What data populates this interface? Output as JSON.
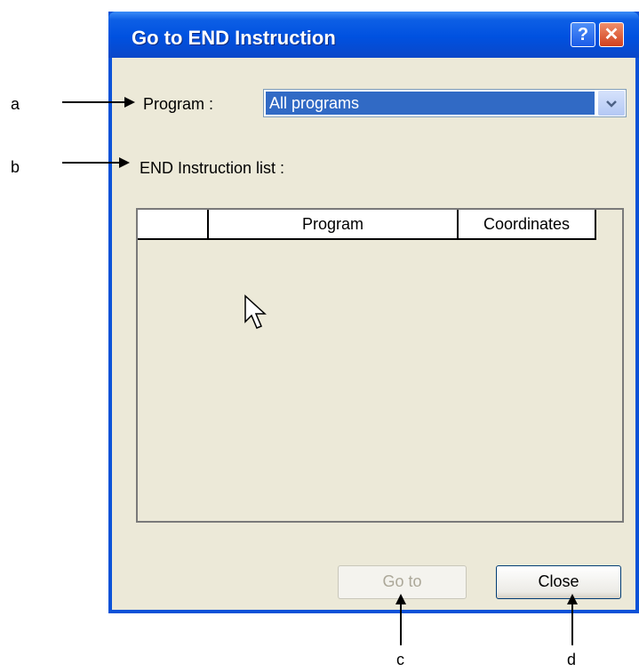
{
  "dialog": {
    "title": "Go to END Instruction",
    "help_button": "?",
    "close_button": "✕"
  },
  "program": {
    "label": "Program :",
    "selected_value": "All programs"
  },
  "end_list": {
    "label": "END Instruction list :",
    "columns": [
      "",
      "Program",
      "Coordinates"
    ]
  },
  "buttons": {
    "goto_label": "Go to",
    "close_label": "Close"
  },
  "callouts": [
    "a",
    "b",
    "c",
    "d"
  ]
}
